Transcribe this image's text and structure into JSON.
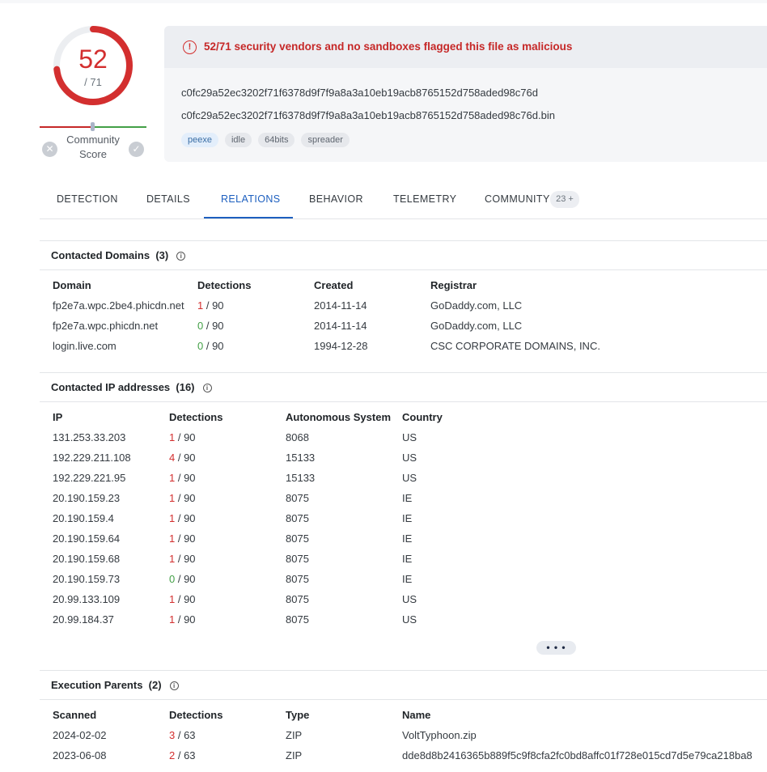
{
  "score": {
    "detected": "52",
    "total": "/ 71",
    "community_label": "Community Score",
    "fraction": 0.732
  },
  "alert": {
    "text": "52/71 security vendors and no sandboxes flagged this file as malicious"
  },
  "file": {
    "hash": "c0fc29a52ec3202f71f6378d9f7f9a8a3a10eb19acb8765152d758aded98c76d",
    "name": "c0fc29a52ec3202f71f6378d9f7f9a8a3a10eb19acb8765152d758aded98c76d.bin",
    "tags": [
      "peexe",
      "idle",
      "64bits",
      "spreader"
    ]
  },
  "tabs": {
    "detection": "DETECTION",
    "details": "DETAILS",
    "relations": "RELATIONS",
    "behavior": "BEHAVIOR",
    "telemetry": "TELEMETRY",
    "community": "COMMUNITY",
    "community_badge": "23 +"
  },
  "domains": {
    "title": "Contacted Domains",
    "count": "(3)",
    "headers": [
      "Domain",
      "Detections",
      "Created",
      "Registrar"
    ],
    "rows": [
      {
        "domain": "fp2e7a.wpc.2be4.phicdn.net",
        "det": "1",
        "det_total": " / 90",
        "created": "2014-11-14",
        "registrar": "GoDaddy.com, LLC"
      },
      {
        "domain": "fp2e7a.wpc.phicdn.net",
        "det": "0",
        "det_total": " / 90",
        "created": "2014-11-14",
        "registrar": "GoDaddy.com, LLC"
      },
      {
        "domain": "login.live.com",
        "det": "0",
        "det_total": " / 90",
        "created": "1994-12-28",
        "registrar": "CSC CORPORATE DOMAINS, INC."
      }
    ]
  },
  "ips": {
    "title": "Contacted IP addresses",
    "count": "(16)",
    "headers": [
      "IP",
      "Detections",
      "Autonomous System",
      "Country"
    ],
    "rows": [
      {
        "ip": "131.253.33.203",
        "det": "1",
        "det_total": " / 90",
        "as": "8068",
        "country": "US"
      },
      {
        "ip": "192.229.211.108",
        "det": "4",
        "det_total": " / 90",
        "as": "15133",
        "country": "US"
      },
      {
        "ip": "192.229.221.95",
        "det": "1",
        "det_total": " / 90",
        "as": "15133",
        "country": "US"
      },
      {
        "ip": "20.190.159.23",
        "det": "1",
        "det_total": " / 90",
        "as": "8075",
        "country": "IE"
      },
      {
        "ip": "20.190.159.4",
        "det": "1",
        "det_total": " / 90",
        "as": "8075",
        "country": "IE"
      },
      {
        "ip": "20.190.159.64",
        "det": "1",
        "det_total": " / 90",
        "as": "8075",
        "country": "IE"
      },
      {
        "ip": "20.190.159.68",
        "det": "1",
        "det_total": " / 90",
        "as": "8075",
        "country": "IE"
      },
      {
        "ip": "20.190.159.73",
        "det": "0",
        "det_total": " / 90",
        "as": "8075",
        "country": "IE"
      },
      {
        "ip": "20.99.133.109",
        "det": "1",
        "det_total": " / 90",
        "as": "8075",
        "country": "US"
      },
      {
        "ip": "20.99.184.37",
        "det": "1",
        "det_total": " / 90",
        "as": "8075",
        "country": "US"
      }
    ],
    "more_label": "• • •"
  },
  "parents": {
    "title": "Execution Parents",
    "count": "(2)",
    "headers": [
      "Scanned",
      "Detections",
      "Type",
      "Name"
    ],
    "rows": [
      {
        "scanned": "2024-02-02",
        "det": "3",
        "det_total": " / 63",
        "type": "ZIP",
        "name": "VoltTyphoon.zip"
      },
      {
        "scanned": "2023-06-08",
        "det": "2",
        "det_total": " / 63",
        "type": "ZIP",
        "name": "dde8d8b2416365b889f5c9f8cfa2fc0bd8affc01f728e015cd7d5e79ca218ba8"
      }
    ]
  },
  "colors": {
    "malicious": "#d32f2f",
    "clean": "#43a047",
    "accent": "#1d5fbf"
  },
  "icons": {
    "alert": "alert-circle-icon",
    "info": "info-icon",
    "thumbs_down": "x-circle-icon",
    "thumbs_up": "check-circle-icon"
  }
}
